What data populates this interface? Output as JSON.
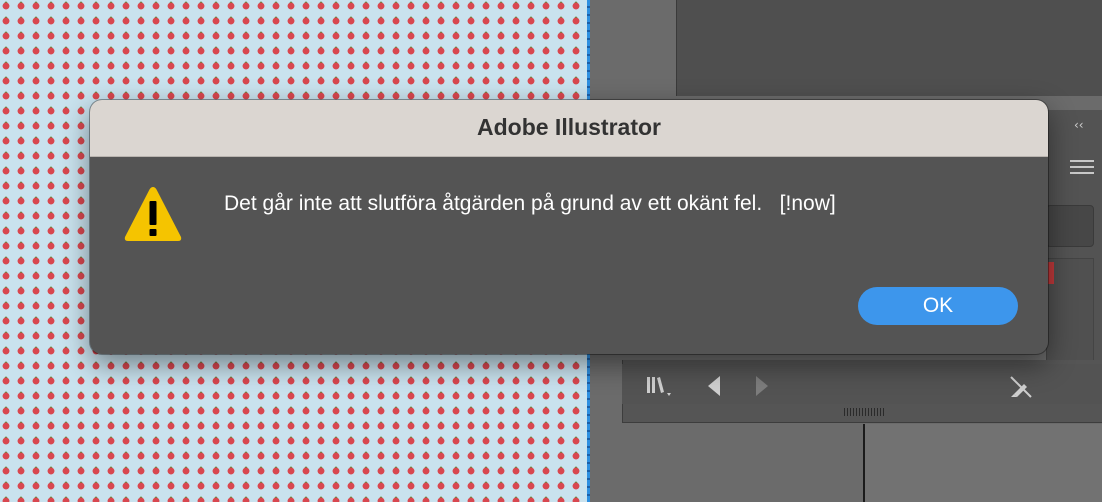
{
  "dialog": {
    "title": "Adobe Illustrator",
    "message": "Det går inte att slutföra åtgärden på grund av ett okänt fel.   [!now]",
    "ok_label": "OK",
    "icon": "warning-icon",
    "accent_color": "#3d96ec",
    "warning_color": "#f5c400"
  },
  "panel": {
    "collapse_label": "‹‹",
    "icons": [
      "libraries-icon",
      "previous-icon",
      "next-icon",
      "brush-remove-icon",
      "panel-menu-icon"
    ]
  }
}
